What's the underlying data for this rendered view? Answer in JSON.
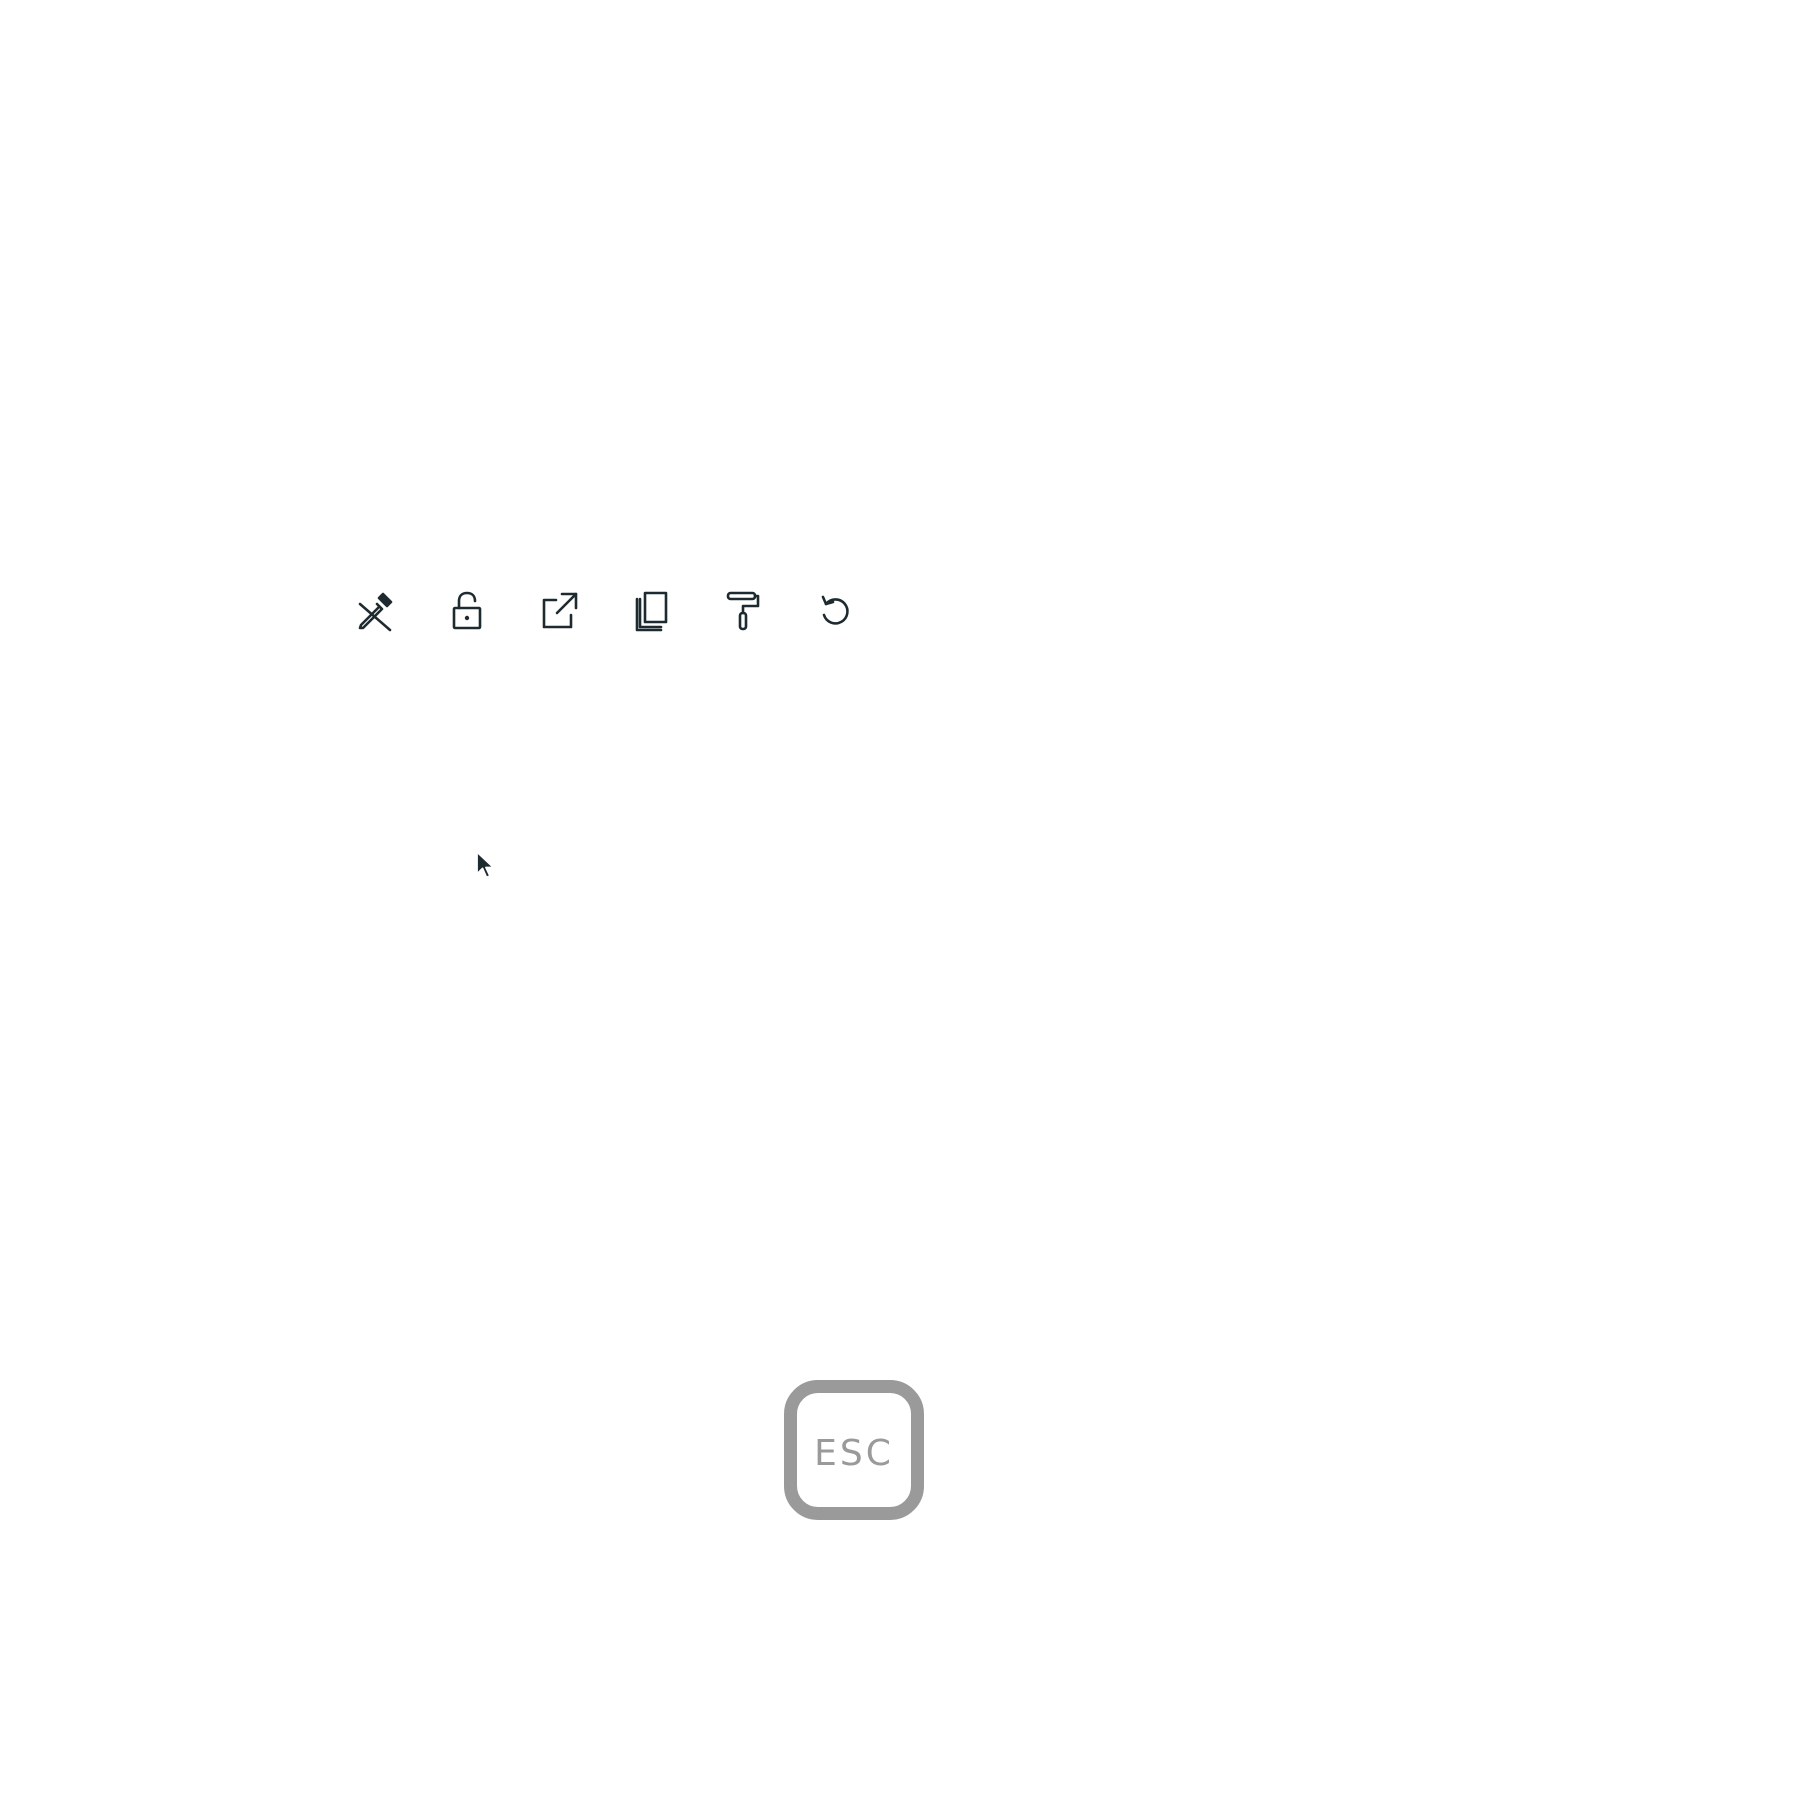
{
  "toolbar": {
    "icon_color": "#1d2b30",
    "items": [
      {
        "icon": "eyedropper-off-icon"
      },
      {
        "icon": "unlock-icon"
      },
      {
        "icon": "external-link-icon"
      },
      {
        "icon": "copy-icon"
      },
      {
        "icon": "paint-roller-icon"
      },
      {
        "icon": "reset-icon"
      }
    ]
  },
  "keyboard_hint": {
    "label": "ESC",
    "color": "#9a9a9a"
  }
}
